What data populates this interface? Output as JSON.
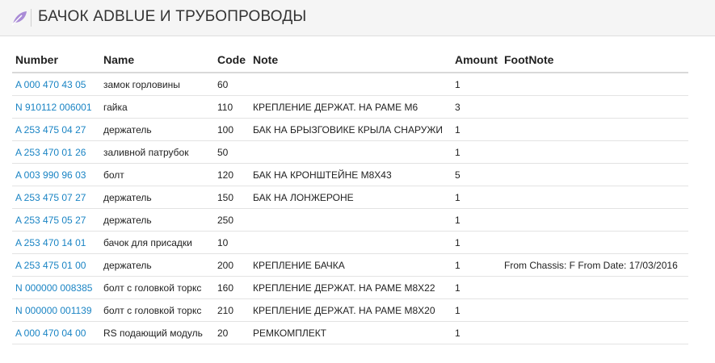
{
  "header": {
    "icon": "feather-leaf-icon",
    "icon_color": "#a98bd6",
    "title": "БАЧОК ADBLUE И ТРУБОПРОВОДЫ"
  },
  "table": {
    "columns": [
      "Number",
      "Name",
      "Code",
      "Note",
      "Amount",
      "FootNote"
    ],
    "link_color": "#1a84c4",
    "rows": [
      {
        "number": "A 000 470 43 05",
        "name": "замок горловины",
        "code": "60",
        "note": "",
        "amount": "1",
        "footnote": ""
      },
      {
        "number": "N 910112 006001",
        "name": "гайка",
        "code": "110",
        "note": "КРЕПЛЕНИЕ ДЕРЖАТ. НА РАМЕ M6",
        "amount": "3",
        "footnote": ""
      },
      {
        "number": "A 253 475 04 27",
        "name": "держатель",
        "code": "100",
        "note": "БАК НА БРЫЗГОВИКЕ КРЫЛА СНАРУЖИ",
        "amount": "1",
        "footnote": ""
      },
      {
        "number": "A 253 470 01 26",
        "name": "заливной патрубок",
        "code": "50",
        "note": "",
        "amount": "1",
        "footnote": ""
      },
      {
        "number": "A 003 990 96 03",
        "name": "болт",
        "code": "120",
        "note": "БАК НА КРОНШТЕЙНЕ M8X43",
        "amount": "5",
        "footnote": ""
      },
      {
        "number": "A 253 475 07 27",
        "name": "держатель",
        "code": "150",
        "note": "БАК НА ЛОНЖЕРОНЕ",
        "amount": "1",
        "footnote": ""
      },
      {
        "number": "A 253 475 05 27",
        "name": "держатель",
        "code": "250",
        "note": "",
        "amount": "1",
        "footnote": ""
      },
      {
        "number": "A 253 470 14 01",
        "name": "бачок для присадки",
        "code": "10",
        "note": "",
        "amount": "1",
        "footnote": ""
      },
      {
        "number": "A 253 475 01 00",
        "name": "держатель",
        "code": "200",
        "note": "КРЕПЛЕНИЕ БАЧКА",
        "amount": "1",
        "footnote": "From Chassis: F From Date: 17/03/2016"
      },
      {
        "number": "N 000000 008385",
        "name": "болт с головкой торкс",
        "code": "160",
        "note": "КРЕПЛЕНИЕ ДЕРЖАТ. НА РАМЕ M8X22",
        "amount": "1",
        "footnote": ""
      },
      {
        "number": "N 000000 001139",
        "name": "болт с головкой торкс",
        "code": "210",
        "note": "КРЕПЛЕНИЕ ДЕРЖАТ. НА РАМЕ M8X20",
        "amount": "1",
        "footnote": ""
      },
      {
        "number": "A 000 470 04 00",
        "name": "RS подающий модуль",
        "code": "20",
        "note": "РЕМКОМПЛЕКТ",
        "amount": "1",
        "footnote": ""
      }
    ]
  }
}
